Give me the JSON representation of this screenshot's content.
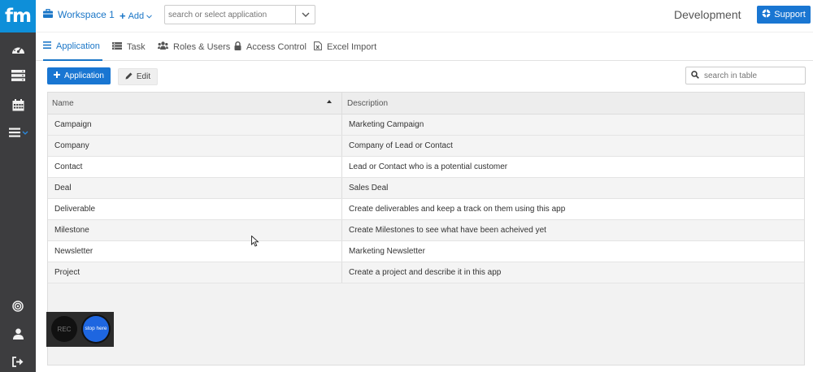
{
  "brand": {
    "logo_text": "fm",
    "accent": "#0e8fd9"
  },
  "sidebar": {
    "items": [
      {
        "icon": "dashboard-icon"
      },
      {
        "icon": "server-icon"
      },
      {
        "icon": "calendar-icon"
      },
      {
        "icon": "menu-icon"
      }
    ],
    "bottom_items": [
      {
        "icon": "target-icon"
      },
      {
        "icon": "user-icon"
      },
      {
        "icon": "sign-out-icon"
      }
    ]
  },
  "header": {
    "workspace": "Workspace 1",
    "add_label": "Add",
    "app_search_placeholder": "search or select application",
    "environment": "Development",
    "support_label": "Support"
  },
  "tabs": [
    {
      "label": "Application",
      "active": true,
      "icon": "list-icon"
    },
    {
      "label": "Task",
      "active": false,
      "icon": "tasks-icon"
    },
    {
      "label": "Roles & Users",
      "active": false,
      "icon": "users-icon"
    },
    {
      "label": "Access Control",
      "active": false,
      "icon": "lock-icon"
    },
    {
      "label": "Excel Import",
      "active": false,
      "icon": "excel-file-icon"
    }
  ],
  "toolbar": {
    "add_application_label": "Application",
    "edit_label": "Edit",
    "table_search_placeholder": "search in table"
  },
  "table": {
    "columns": [
      "Name",
      "Description"
    ],
    "sort": {
      "column": "Name",
      "direction": "ascending"
    },
    "rows": [
      {
        "name": "Campaign",
        "description": "Marketing Campaign"
      },
      {
        "name": "Company",
        "description": "Company of Lead or Contact"
      },
      {
        "name": "Contact",
        "description": "Lead or Contact who is a potential customer"
      },
      {
        "name": "Deal",
        "description": "Sales Deal"
      },
      {
        "name": "Deliverable",
        "description": "Create deliverables and keep a track on them using this app"
      },
      {
        "name": "Milestone",
        "description": "Create Milestones to see what have been acheived yet"
      },
      {
        "name": "Newsletter",
        "description": "Marketing Newsletter"
      },
      {
        "name": "Project",
        "description": "Create a project and describe it in this app"
      }
    ]
  },
  "recorder": {
    "rec_label": "REC",
    "stop_label": "stop here"
  }
}
